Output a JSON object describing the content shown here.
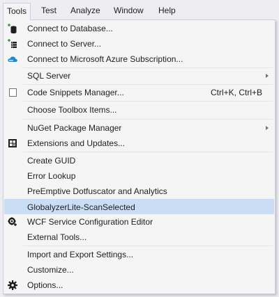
{
  "menubar": {
    "items": [
      {
        "label": "Tools"
      },
      {
        "label": "Test"
      },
      {
        "label": "Analyze"
      },
      {
        "label": "Window"
      },
      {
        "label": "Help"
      }
    ]
  },
  "tools_menu": {
    "items": [
      {
        "label": "Connect to Database...",
        "icon": "database-connect-icon"
      },
      {
        "label": "Connect to Server...",
        "icon": "server-connect-icon"
      },
      {
        "label": "Connect to Microsoft Azure Subscription...",
        "icon": "azure-cloud-icon"
      },
      {
        "label": "SQL Server",
        "has_submenu": true
      },
      {
        "label": "Code Snippets Manager...",
        "shortcut": "Ctrl+K, Ctrl+B",
        "icon": "checkbox-icon"
      },
      {
        "label": "Choose Toolbox Items..."
      },
      {
        "label": "NuGet Package Manager",
        "has_submenu": true
      },
      {
        "label": "Extensions and Updates...",
        "icon": "extensions-icon"
      },
      {
        "label": "Create GUID"
      },
      {
        "label": "Error Lookup"
      },
      {
        "label": "PreEmptive Dotfuscator and Analytics"
      },
      {
        "label": "GlobalyzerLite-ScanSelected",
        "highlighted": true
      },
      {
        "label": "WCF Service Configuration Editor",
        "icon": "wcf-config-icon"
      },
      {
        "label": "External Tools..."
      },
      {
        "label": "Import and Export Settings..."
      },
      {
        "label": "Customize..."
      },
      {
        "label": "Options...",
        "icon": "gear-icon"
      }
    ]
  },
  "colors": {
    "highlight": "#c9def5",
    "menu_background": "#f5f5f5",
    "menubar_background": "#eeeef2",
    "border": "#cccedb",
    "azure_blue": "#1e88d8",
    "connect_green": "#3a9a3a"
  }
}
